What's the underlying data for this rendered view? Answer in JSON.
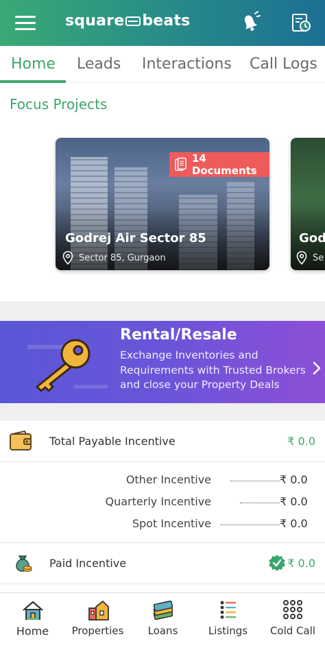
{
  "header": {
    "logo_left": "square",
    "logo_right": "beats"
  },
  "tabs": [
    {
      "label": "Home",
      "active": true
    },
    {
      "label": "Leads"
    },
    {
      "label": "Interactions"
    },
    {
      "label": "Call Logs"
    }
  ],
  "focus": {
    "title": "Focus Projects",
    "cards": [
      {
        "badge": "14 Documents",
        "name": "Godrej Air Sector 85",
        "location": "Sector 85, Gurgaon"
      },
      {
        "name": "God",
        "location": "Se"
      }
    ]
  },
  "banner": {
    "title": "Rental/Resale",
    "text": "Exchange Inventories and Requirements with Trusted Brokers and close your Property Deals"
  },
  "incentives": {
    "total_label": "Total Payable Incentive",
    "total_value": "₹ 0.0",
    "rows": [
      {
        "label": "Other Incentive",
        "value": "₹ 0.0"
      },
      {
        "label": "Quarterly Incentive",
        "value": "₹ 0.0"
      },
      {
        "label": "Spot Incentive",
        "value": "₹ 0.0"
      }
    ],
    "paid_label": "Paid Incentive",
    "paid_value": "₹ 0.0"
  },
  "nav": [
    {
      "label": "Home",
      "icon": "house-icon"
    },
    {
      "label": "Properties",
      "icon": "properties-icon"
    },
    {
      "label": "Loans",
      "icon": "cash-stack-icon"
    },
    {
      "label": "Listings",
      "icon": "list-icon"
    },
    {
      "label": "Cold Call",
      "icon": "dialpad-icon"
    }
  ],
  "colors": {
    "accent": "#3aa76d",
    "badge": "#ef5b5b",
    "banner": "#6a55d9"
  }
}
